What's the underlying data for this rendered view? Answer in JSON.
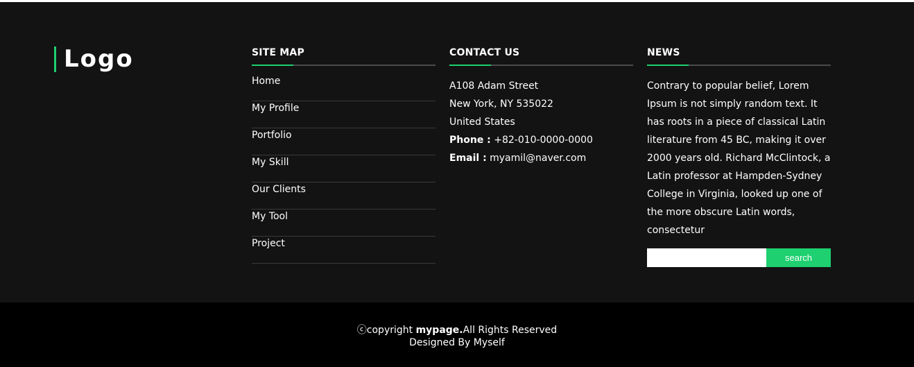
{
  "logo": {
    "text": "Logo"
  },
  "sitemap": {
    "title": "SITE MAP",
    "items": [
      {
        "label": "Home"
      },
      {
        "label": "My Profile"
      },
      {
        "label": "Portfolio"
      },
      {
        "label": "My Skill"
      },
      {
        "label": "Our Clients"
      },
      {
        "label": "My Tool"
      },
      {
        "label": "Project"
      }
    ]
  },
  "contact": {
    "title": "CONTACT US",
    "address_line1": "A108 Adam Street",
    "address_line2": "New York, NY 535022",
    "address_line3": "United States",
    "phone_label": "Phone :",
    "phone_value": "+82-010-0000-0000",
    "email_label": "Email :",
    "email_value": "myamil@naver.com"
  },
  "news": {
    "title": "NEWS",
    "text": "Contrary to popular belief, Lorem Ipsum is not simply random text. It has roots in a piece of classical Latin literature from 45 BC, making it over 2000 years old. Richard McClintock, a Latin professor at Hampden-Sydney College in Virginia, looked up one of the more obscure Latin words, consectetur",
    "search_value": "",
    "search_button": "search"
  },
  "bottom": {
    "copyright_prefix": "ⓒcopyright ",
    "brand": "mypage.",
    "rights": "All Rights Reserved",
    "designed_by": "Designed By Myself"
  },
  "colors": {
    "accent": "#1ed06f",
    "footer_bg": "#131313",
    "bottom_bg": "#000000"
  }
}
